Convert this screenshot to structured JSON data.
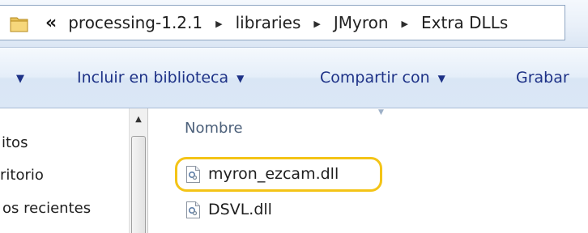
{
  "address_bar": {
    "overflow_glyph": "«",
    "crumbs": [
      "processing-1.2.1",
      "libraries",
      "JMyron",
      "Extra DLLs"
    ],
    "separator_glyph": "▶"
  },
  "toolbar": {
    "organize_caret": "▼",
    "include_label": "Incluir en biblioteca",
    "share_label": "Compartir con",
    "burn_label": "Grabar",
    "caret": "▼"
  },
  "nav_pane": {
    "items": [
      "itos",
      "ritorio",
      "os recientes"
    ],
    "scroll_up_glyph": "▲"
  },
  "file_list": {
    "column_header": "Nombre",
    "files": [
      {
        "name": "myron_ezcam.dll",
        "icon": "dll-file-icon",
        "highlighted": true
      },
      {
        "name": "DSVL.dll",
        "icon": "dll-file-icon",
        "highlighted": false
      }
    ]
  },
  "colors": {
    "highlight": "#f4c417",
    "toolbar_text": "#1e3287",
    "header_text": "#4c607a"
  }
}
